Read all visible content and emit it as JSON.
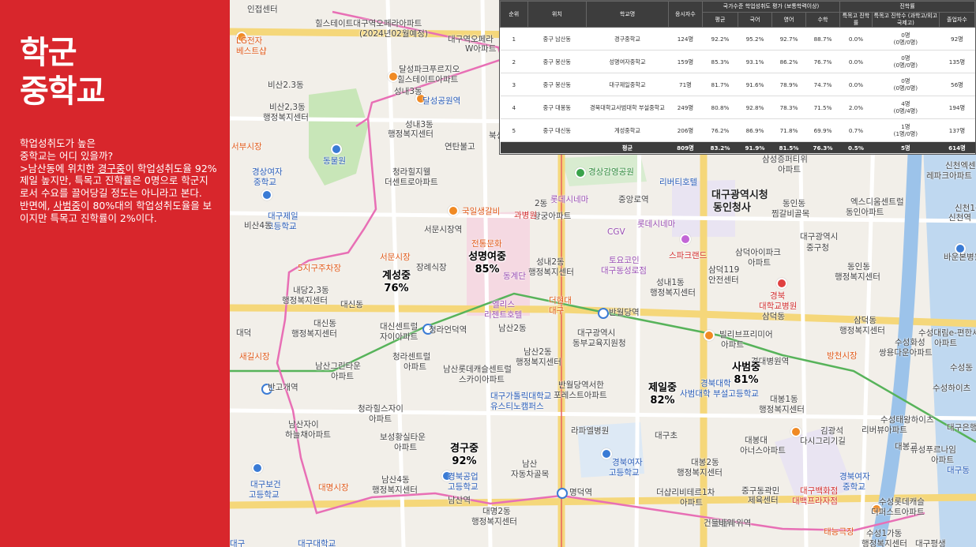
{
  "panel": {
    "title_line1": "학군",
    "title_line2": "중학교",
    "desc_q1": "학업성취도가 높은",
    "desc_q2": "중학교는 어디 있을까?",
    "desc_p1_pre": ">남산동에 위치한 ",
    "desc_p1_school": "경구중",
    "desc_p1_post": "이 학업성취도율 92% 제일 높지만, 특목고 진학률은 0명으로 학군지로서 수요를 끌어당길 정도는 아니라고 본다.",
    "desc_p2_pre": "반면에, ",
    "desc_p2_school": "사범중",
    "desc_p2_post": "이 80%대의 학업성취도율을 보이지만 특목고 진학률이 2%이다."
  },
  "table": {
    "headers": {
      "rank": "순위",
      "location": "위치",
      "school": "학교명",
      "applicants": "응시자수",
      "achievement_group": "국가수준 학업성취도 평가 (보통학력이상)",
      "avg": "평균",
      "korean": "국어",
      "english": "영어",
      "math": "수학",
      "progress_group": "진학률",
      "special_rate": "특목고 진학률",
      "special_count": "특목고 진학수 (과학고/외고국제고)",
      "graduates": "졸업자수"
    },
    "rows": [
      {
        "rank": "1",
        "location": "중구 남산동",
        "school": "경구중학교",
        "applicants": "124명",
        "avg": "92.2%",
        "korean": "95.2%",
        "english": "92.7%",
        "math": "88.7%",
        "special_rate": "0.0%",
        "special_count": "0명",
        "special_detail": "(0명/0명)",
        "graduates": "92명"
      },
      {
        "rank": "2",
        "location": "중구 봉산동",
        "school": "성명여자중학교",
        "applicants": "159명",
        "avg": "85.3%",
        "korean": "93.1%",
        "english": "86.2%",
        "math": "76.7%",
        "special_rate": "0.0%",
        "special_count": "0명",
        "special_detail": "(0명/0명)",
        "graduates": "135명"
      },
      {
        "rank": "3",
        "location": "중구 봉산동",
        "school": "대구제일중학교",
        "applicants": "71명",
        "avg": "81.7%",
        "korean": "91.6%",
        "english": "78.9%",
        "math": "74.7%",
        "special_rate": "0.0%",
        "special_count": "0명",
        "special_detail": "(0명/0명)",
        "graduates": "56명"
      },
      {
        "rank": "4",
        "location": "중구 대봉동",
        "school": "경북대학교사범대학 부설중학교",
        "applicants": "249명",
        "avg": "80.8%",
        "korean": "92.8%",
        "english": "78.3%",
        "math": "71.5%",
        "special_rate": "2.0%",
        "special_count": "4명",
        "special_detail": "(0명/4명)",
        "graduates": "194명"
      },
      {
        "rank": "5",
        "location": "중구 대신동",
        "school": "계성중학교",
        "applicants": "206명",
        "avg": "76.2%",
        "korean": "86.9%",
        "english": "71.8%",
        "math": "69.9%",
        "special_rate": "0.7%",
        "special_count": "1명",
        "special_detail": "(1명/0명)",
        "graduates": "137명"
      }
    ],
    "avg_row": {
      "label": "평균",
      "applicants": "809명",
      "avg": "83.2%",
      "korean": "91.9%",
      "english": "81.5%",
      "math": "76.3%",
      "special_rate": "0.5%",
      "special_count": "5명",
      "graduates": "614명"
    }
  },
  "schools": [
    {
      "name": "성명여중",
      "rate": "85%"
    },
    {
      "name": "계성중",
      "rate": "76%"
    },
    {
      "name": "사범중",
      "rate": "81%"
    },
    {
      "name": "제일중",
      "rate": "82%"
    },
    {
      "name": "경구중",
      "rate": "92%"
    }
  ],
  "map_labels": [
    "인접센터",
    "힐스테이트대구역오페라아파트",
    "(2024년02월예정)",
    "대구역오페라",
    "W아파트",
    "LG전자",
    "베스트샵",
    "비산2.3동",
    "달성파크푸르지오",
    "힐스테이트아파트",
    "비산2,3동",
    "행정복지센터",
    "성내3동",
    "달성공원역",
    "성내3동",
    "행정복지센터",
    "연탄불고",
    "북성",
    "서부시장",
    "동물원",
    "경상여자",
    "중학교",
    "대구제일",
    "고등학교",
    "비산4동",
    "청라힐지웰",
    "더센트로아파트",
    "경상감영공원",
    "리버티호텔",
    "대구광역시청",
    "동인청사",
    "국일생갈비",
    "2동",
    "롯데시네마",
    "중앙로역",
    "황궁아파트",
    "CGV",
    "롯데시네마",
    "과병원",
    "서문시장역",
    "전통문화",
    "성내2동",
    "행정복지센터",
    "토요코인",
    "대구동성로점",
    "스파크랜드",
    "삼덕아이파크",
    "아파트",
    "성내1동",
    "행정복지센터",
    "삼덕119",
    "안전센터",
    "경북",
    "대학교병원",
    "삼덕동",
    "서문시장",
    "5지구주차장",
    "장례식장",
    "동계단",
    "내당2,3동",
    "행정복지센터",
    "대신동",
    "엘리스",
    "리젠트호텔",
    "반월당역",
    "더현대",
    "대구",
    "대신동",
    "행정복지센터",
    "대신센트럴",
    "자이아파트",
    "청라언덕역",
    "남산2동",
    "대구광역시",
    "동부교육지원청",
    "빌리브프리미어",
    "아파트",
    "새길시장",
    "청라센트럴",
    "아파트",
    "남산그린타운",
    "아파트",
    "남산2동",
    "행정복지센터",
    "남산롯데캐슬센트럴",
    "스카이아파트",
    "반월당역서한",
    "포레스트아파트",
    "경북대학",
    "사범대학 부설고등학교",
    "대봉1동",
    "행정복지센터",
    "반고개역",
    "대구가톨릭대학교",
    "유스티노캠퍼스",
    "청라힐스자이",
    "아파트",
    "남산자이",
    "하늘채아파트",
    "보성황실타운",
    "아파트",
    "라파엘병원",
    "대구초",
    "대봉대",
    "아너스아파트",
    "대봉2동",
    "행정복지센터",
    "경북여자",
    "고등학교",
    "대구보건",
    "고등학교",
    "대명시장",
    "남산4동",
    "행정복지센터",
    "경북공업",
    "고등학교",
    "남산",
    "자동차골목",
    "남산역",
    "대명2동",
    "행정복지센터",
    "명덕역",
    "더샵리비테르1차",
    "아파트",
    "중구동곽민",
    "제육센터",
    "대구백화점",
    "대백프라자점",
    "건들바위역",
    "수성1가동",
    "행정복지센터",
    "대구",
    "대구대학교",
    "동인동",
    "찜갈비골목",
    "대구광역시",
    "중구청",
    "동인동",
    "행정복지센터",
    "엑스디움센트럴",
    "동인아파트",
    "신천1동",
    "바운본병원",
    "삼덕동",
    "행정복지센터",
    "경대병원역",
    "방천시장",
    "수성대림e-편한세상",
    "아파트",
    "수성화성",
    "쌍용다운아파트",
    "수성동",
    "수성하이츠",
    "수성태왕하이츠",
    "리버뷰아파트",
    "대구은행",
    "유성푸르나임",
    "아파트",
    "대구동",
    "신천역",
    "신천엑센트",
    "레파크아파트",
    "삼성증퍼티위",
    "아파트",
    "김광석",
    "다시그리기길",
    "수성롯데캐슬",
    "더퍼스트아파트",
    "태능극장",
    "대구평생",
    "대봉교",
    "경북여자",
    "중학교",
    "건들바위",
    "대덕"
  ]
}
